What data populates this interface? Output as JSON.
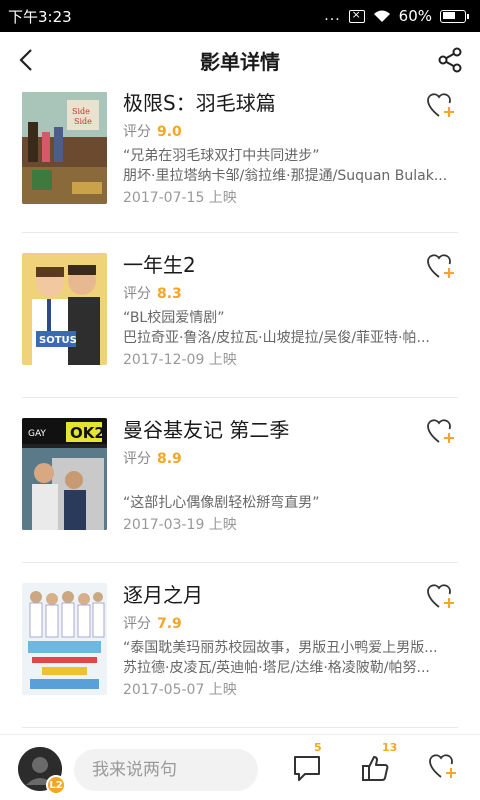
{
  "status_bar": {
    "time": "下午3:23",
    "dots": "...",
    "battery": "60%"
  },
  "header": {
    "title": "影单详情"
  },
  "rating_label": "评分",
  "movies": [
    {
      "title": "极限S：羽毛球篇",
      "score": "9.0",
      "quote": "“兄弟在羽毛球双打中共同进步”",
      "cast": "朋坏·里拉塔纳卡邹/翁拉维·那提通/Suquan Bulak...",
      "release": "2017-07-15 上映"
    },
    {
      "title": "一年生2",
      "score": "8.3",
      "quote": "“BL校园爱情剧”",
      "cast": "巴拉奇亚·鲁洛/皮拉瓦·山坡提拉/吴俊/菲亚特·帕...",
      "release": "2017-12-09 上映"
    },
    {
      "title": "曼谷基友记 第二季",
      "score": "8.9",
      "quote": "“这部扎心偶像剧轻松掰弯直男”",
      "cast": "",
      "release": "2017-03-19 上映"
    },
    {
      "title": "逐月之月",
      "score": "7.9",
      "quote": "“泰国耽美玛丽苏校园故事，男版丑小鸭爱上男版...",
      "cast": "苏拉德·皮凌瓦/英迪帕·塔尼/达维·格凌陂勒/帕努...",
      "release": "2017-05-07 上映"
    }
  ],
  "bottom_bar": {
    "avatar_level": "L2",
    "comment_placeholder": "我来说两句",
    "comment_count": "5",
    "like_count": "13"
  },
  "colors": {
    "accent": "#f5a623",
    "text_primary": "#1a1a1a",
    "text_secondary": "#666666"
  },
  "icons": [
    "back-arrow-icon",
    "share-icon",
    "heart-plus-icon",
    "comment-icon",
    "thumbs-up-icon"
  ]
}
